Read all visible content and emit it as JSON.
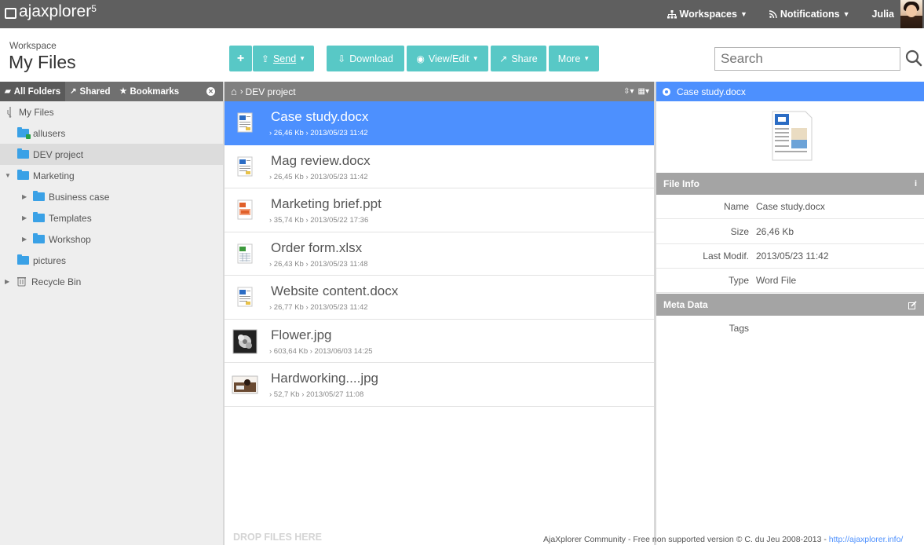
{
  "app": {
    "logo_text": "ajaxplorer",
    "logo_version": "5"
  },
  "topnav": {
    "workspaces": "Workspaces",
    "notifications": "Notifications",
    "user": "Julia"
  },
  "workspace": {
    "label": "Workspace",
    "title": "My Files"
  },
  "toolbar": {
    "add": "+",
    "send": "Send",
    "download": "Download",
    "view_edit": "View/Edit",
    "share": "Share",
    "more": "More"
  },
  "search": {
    "placeholder": "Search"
  },
  "left_tabs": {
    "all_folders": "All Folders",
    "shared": "Shared",
    "bookmarks": "Bookmarks"
  },
  "tree": [
    {
      "label": "My Files"
    },
    {
      "label": "allusers"
    },
    {
      "label": "DEV project"
    },
    {
      "label": "Marketing"
    },
    {
      "label": "Business case"
    },
    {
      "label": "Templates"
    },
    {
      "label": "Workshop"
    },
    {
      "label": "pictures"
    },
    {
      "label": "Recycle Bin"
    }
  ],
  "center": {
    "breadcrumb": "DEV project",
    "drop_label": "DROP FILES HERE"
  },
  "files": [
    {
      "name": "Case study.docx",
      "meta": "› 26,46 Kb › 2013/05/23 11:42",
      "type": "doc"
    },
    {
      "name": "Mag review.docx",
      "meta": "› 26,45 Kb › 2013/05/23 11:42",
      "type": "doc"
    },
    {
      "name": "Marketing brief.ppt",
      "meta": "› 35,74 Kb › 2013/05/22 17:36",
      "type": "ppt"
    },
    {
      "name": "Order form.xlsx",
      "meta": "› 26,43 Kb › 2013/05/23 11:48",
      "type": "xls"
    },
    {
      "name": "Website content.docx",
      "meta": "› 26,77 Kb › 2013/05/23 11:42",
      "type": "doc"
    },
    {
      "name": "Flower.jpg",
      "meta": "› 603,64 Kb › 2013/06/03 14:25",
      "type": "img"
    },
    {
      "name": "Hardworking....jpg",
      "meta": "› 52,7 Kb › 2013/05/27 11:08",
      "type": "img"
    }
  ],
  "details": {
    "title": "Case study.docx",
    "file_info_label": "File Info",
    "meta_data_label": "Meta Data",
    "rows": [
      {
        "key": "Name",
        "value": "Case study.docx"
      },
      {
        "key": "Size",
        "value": "26,46 Kb"
      },
      {
        "key": "Last Modif.",
        "value": "2013/05/23 11:42"
      },
      {
        "key": "Type",
        "value": "Word File"
      }
    ],
    "tags_label": "Tags"
  },
  "footer": {
    "text": "AjaXplorer Community - Free non supported version © C. du Jeu 2008-2013 - ",
    "link": "http://ajaxplorer.info/"
  },
  "colors": {
    "accent": "#58c8c6",
    "selection": "#4d90fe",
    "topbar": "#5f5f5f"
  }
}
